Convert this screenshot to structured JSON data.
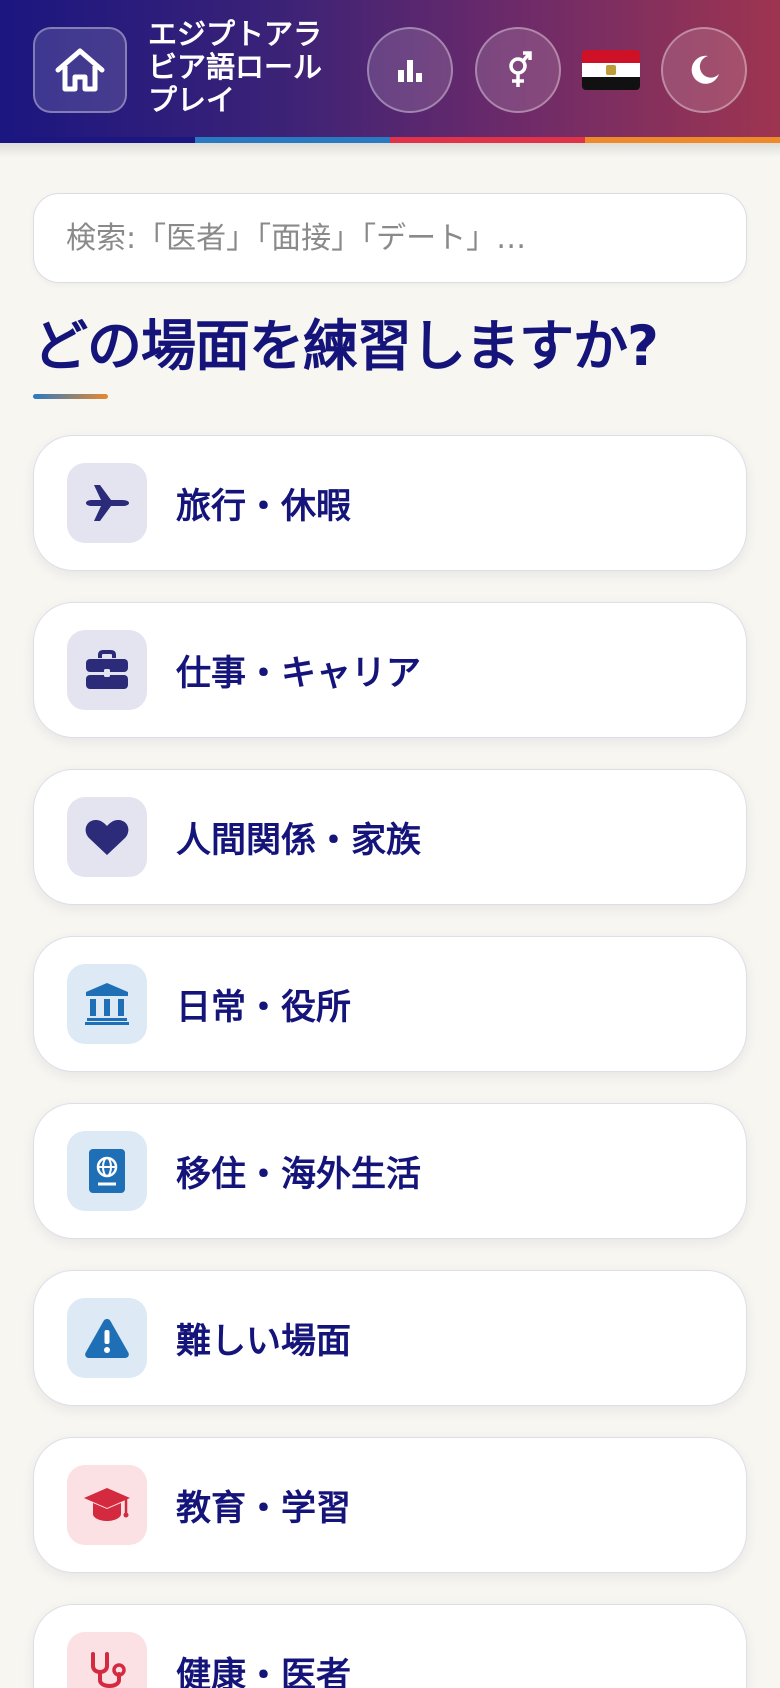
{
  "header": {
    "app_title": "エジプトアラビア語ロールプレイ",
    "home_icon": "home-icon",
    "stats_icon": "bar-chart-icon",
    "gender_icon": "gender-icon",
    "flag": "egypt-flag",
    "theme_icon": "moon-icon",
    "stripe_colors": [
      "#1b1680",
      "#2a7ac2",
      "#e0334a",
      "#ee8a2a"
    ]
  },
  "search": {
    "placeholder": "検索:「医者」「面接」「デート」…",
    "value": ""
  },
  "main": {
    "heading": "どの場面を練習しますか?",
    "categories": [
      {
        "label": "旅行・休暇",
        "icon": "airplane-icon",
        "icon_color": "#2b2b7a",
        "bg": "#e4e4f0"
      },
      {
        "label": "仕事・キャリア",
        "icon": "briefcase-icon",
        "icon_color": "#2b2b7a",
        "bg": "#e4e4f0"
      },
      {
        "label": "人間関係・家族",
        "icon": "heart-icon",
        "icon_color": "#2b2b7a",
        "bg": "#e4e4f0"
      },
      {
        "label": "日常・役所",
        "icon": "bank-icon",
        "icon_color": "#1e6fb5",
        "bg": "#dde9f5"
      },
      {
        "label": "移住・海外生活",
        "icon": "passport-icon",
        "icon_color": "#1e6fb5",
        "bg": "#dde9f5"
      },
      {
        "label": "難しい場面",
        "icon": "warning-icon",
        "icon_color": "#1e6fb5",
        "bg": "#dde9f5"
      },
      {
        "label": "教育・学習",
        "icon": "graduation-cap-icon",
        "icon_color": "#d42a3f",
        "bg": "#fbe0e4"
      },
      {
        "label": "健康・医者",
        "icon": "stethoscope-icon",
        "icon_color": "#d42a3f",
        "bg": "#fbe0e4"
      }
    ]
  }
}
